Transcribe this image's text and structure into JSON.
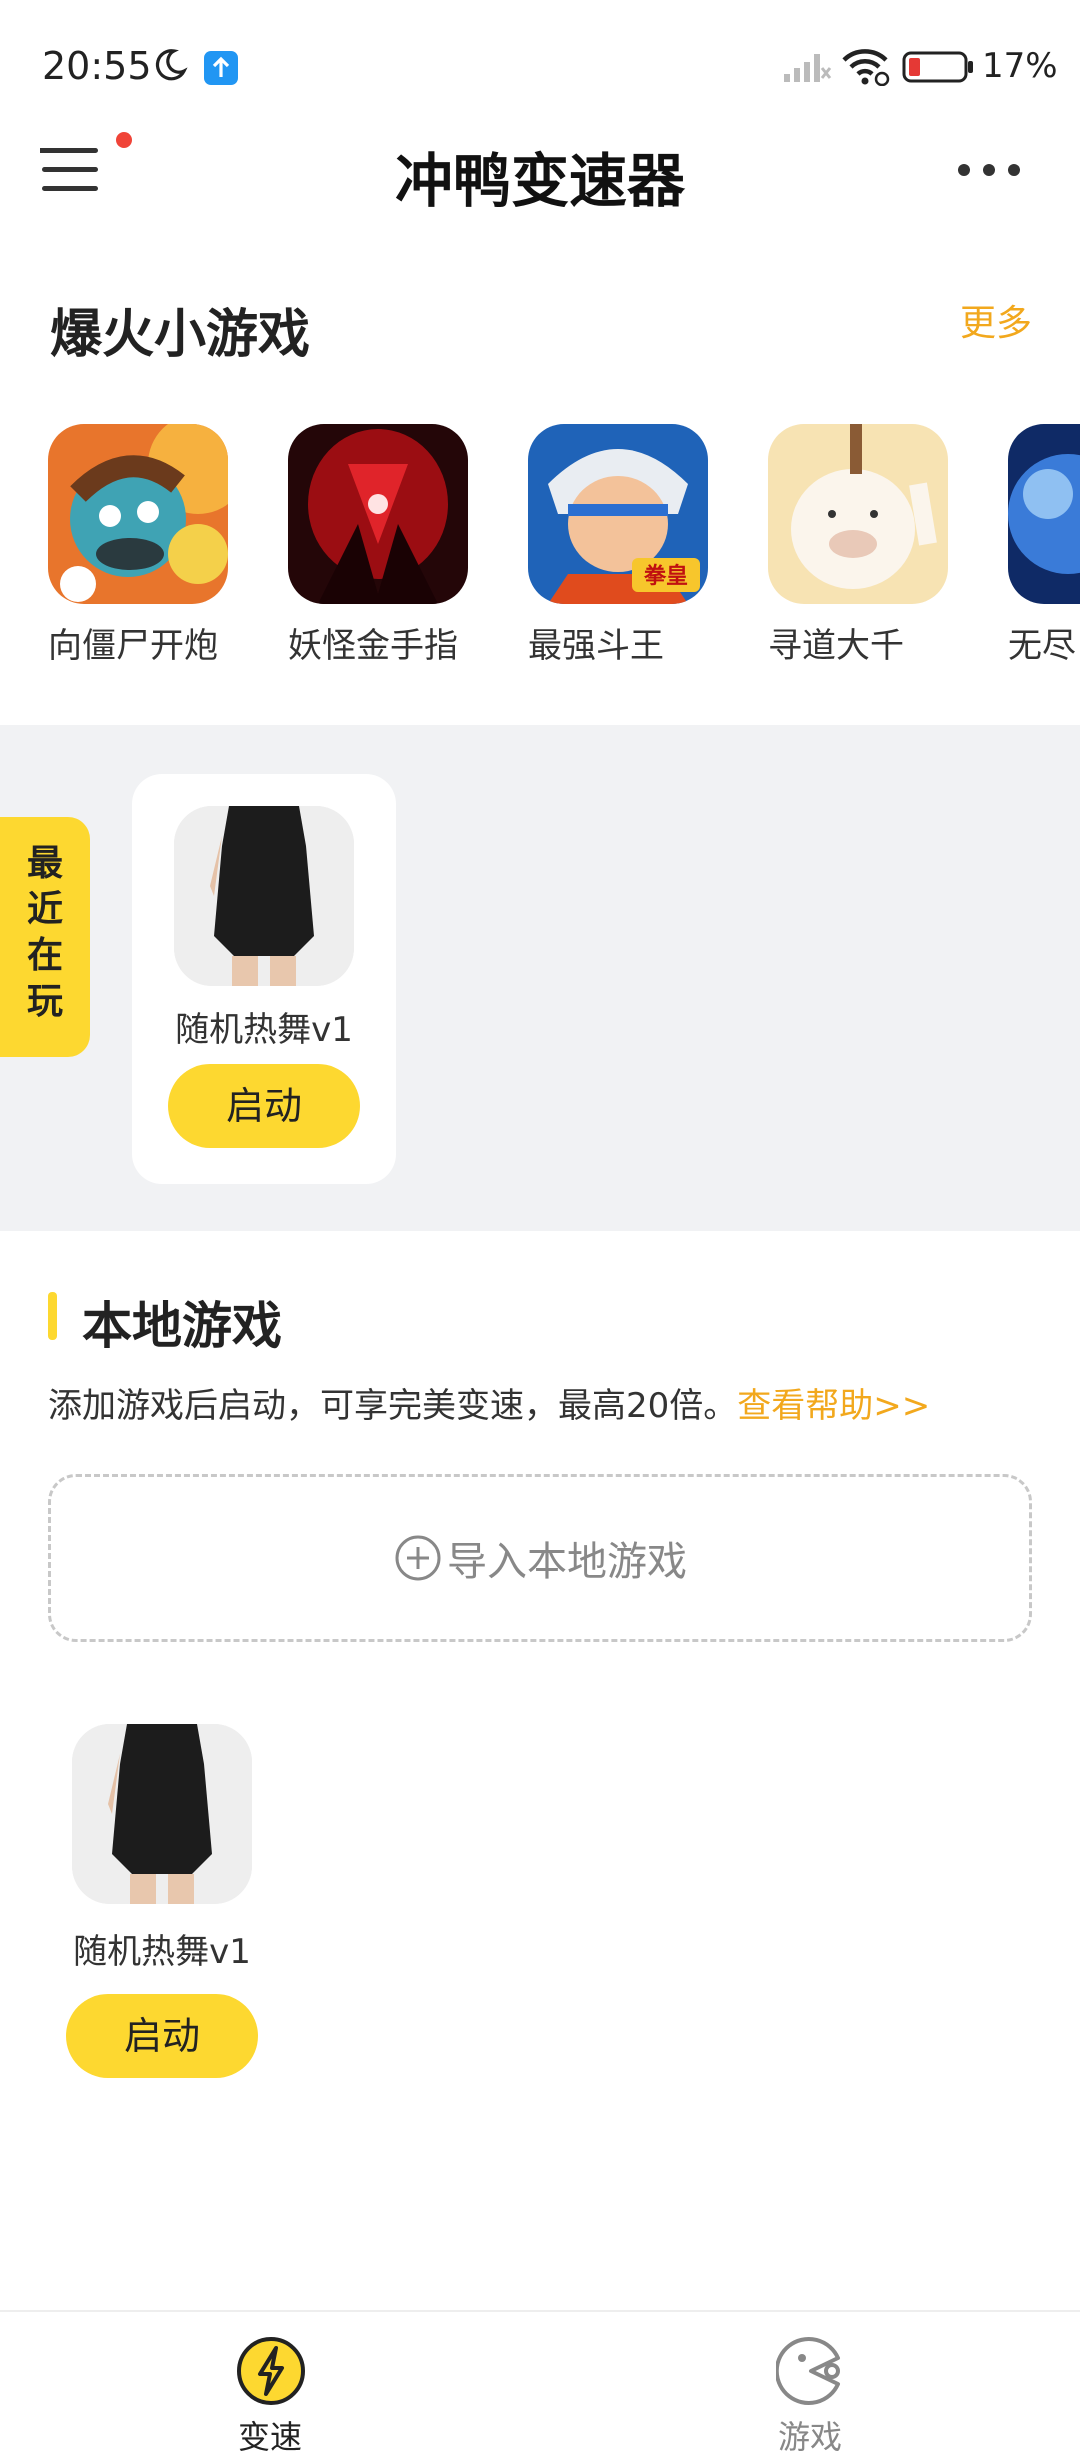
{
  "status_bar": {
    "time": "20:55",
    "battery": "17%",
    "icons": [
      "moon-icon",
      "notification-icon",
      "signal-icon",
      "wifi-icon",
      "battery-icon"
    ]
  },
  "header": {
    "title": "冲鸭变速器",
    "menu_icon": "menu-icon",
    "more_icon": "more-icon"
  },
  "hot_games": {
    "title": "爆火小游戏",
    "more_label": "更多",
    "items": [
      {
        "name": "向僵尸开炮"
      },
      {
        "name": "妖怪金手指"
      },
      {
        "name": "最强斗王",
        "badge": "拳皇"
      },
      {
        "name": "寻道大千"
      },
      {
        "name": "无尽"
      }
    ]
  },
  "recent": {
    "tab_label": "最近在玩",
    "items": [
      {
        "name": "随机热舞v1",
        "button": "启动"
      }
    ]
  },
  "local_games": {
    "title": "本地游戏",
    "description": "添加游戏后启动，可享完美变速，最高20倍。",
    "help_link": "查看帮助>>",
    "import_label": "导入本地游戏",
    "items": [
      {
        "name": "随机热舞v1",
        "button": "启动"
      }
    ]
  },
  "bottom_nav": {
    "items": [
      {
        "label": "变速",
        "icon": "lightning-icon",
        "active": true
      },
      {
        "label": "游戏",
        "icon": "game-icon",
        "active": false
      }
    ]
  },
  "colors": {
    "accent_yellow": "#fdd830",
    "accent_orange": "#f2a81d",
    "notification_red": "#f04438",
    "section_gray": "#f1f2f4"
  }
}
